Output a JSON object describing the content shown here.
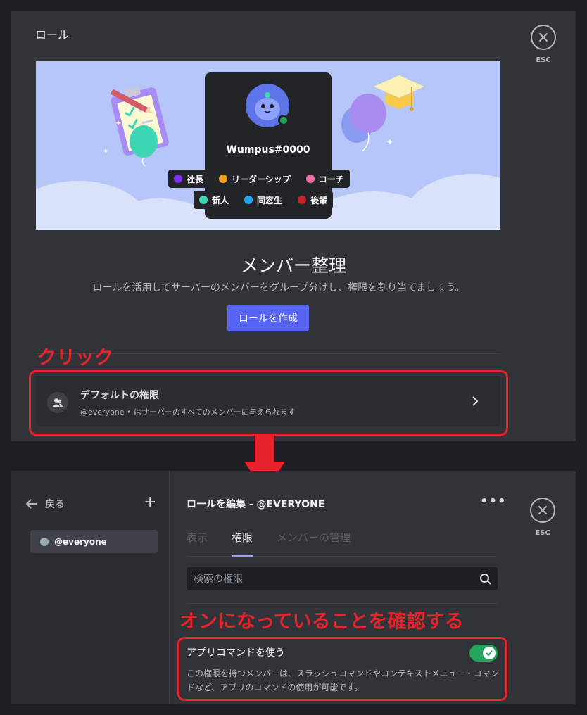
{
  "top": {
    "title": "ロール",
    "esc_label": "ESC",
    "banner": {
      "username": "Wumpus#0000",
      "roles": [
        {
          "label": "社長",
          "color": "#7b2ff7"
        },
        {
          "label": "リーダーシップ",
          "color": "#f0a020"
        },
        {
          "label": "コーチ",
          "color": "#eb6fa3"
        },
        {
          "label": "新人",
          "color": "#3ed6b5"
        },
        {
          "label": "同窓生",
          "color": "#1ea7f0"
        },
        {
          "label": "後輩",
          "color": "#c8242d"
        }
      ]
    },
    "heading": "メンバー整理",
    "subtext": "ロールを活用してサーバーのメンバーをグループ分けし、権限を割り当てましょう。",
    "create_button": "ロールを作成",
    "default_permissions": {
      "title": "デフォルトの権限",
      "description": "@everyone • はサーバーのすべてのメンバーに与えられます"
    }
  },
  "annotations": {
    "click_label": "クリック",
    "confirm_label": "オンになっていることを確認する",
    "color": "#e8232b"
  },
  "bottom": {
    "back_label": "戻る",
    "add_icon": "+",
    "role_item": "@everyone",
    "edit_title": "ロールを編集 - @EVERYONE",
    "more_icon": "•••",
    "esc_label": "ESC",
    "tabs": [
      {
        "label": "表示",
        "active": false
      },
      {
        "label": "権限",
        "active": true
      },
      {
        "label": "メンバーの管理",
        "active": false
      }
    ],
    "search_placeholder": "検索の権限",
    "permission": {
      "title": "アプリコマンドを使う",
      "enabled": true,
      "description": "この権限を持つメンバーは、スラッシュコマンドやコンテキストメニュー・コマンドなど、アプリのコマンドの使用が可能です。"
    }
  },
  "colors": {
    "accent": "#5865f2",
    "toggle_on": "#23a55a"
  }
}
